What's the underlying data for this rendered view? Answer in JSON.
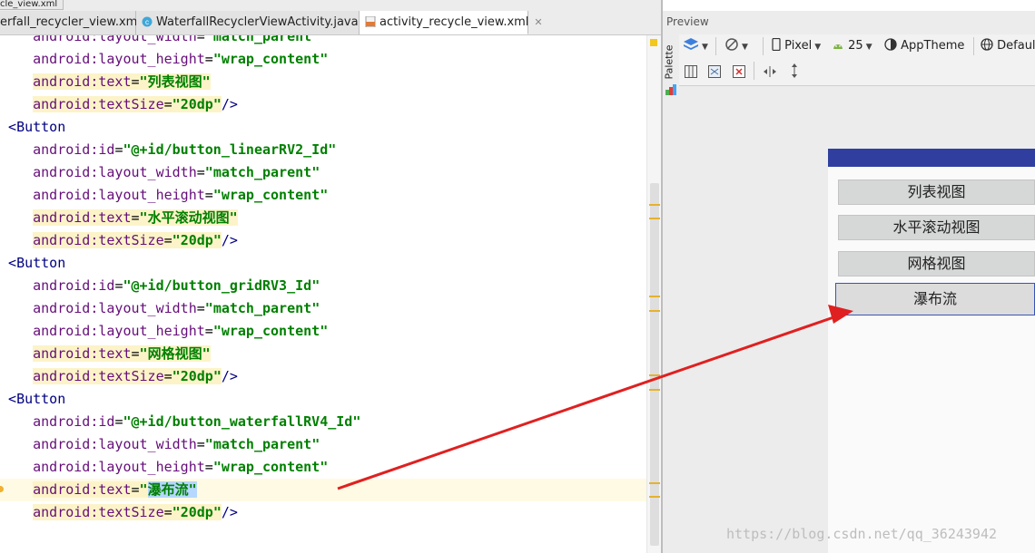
{
  "tabs": {
    "crumb": "cle_view.xml",
    "items": [
      {
        "label": "erfall_recycler_view.xml"
      },
      {
        "label": "WaterfallRecyclerViewActivity.java"
      },
      {
        "label": "activity_recycle_view.xml"
      }
    ]
  },
  "editor": {
    "lines": [
      {
        "indent": "    ",
        "attr": "android:layout_width",
        "value": "match_parent",
        "tail": ""
      },
      {
        "indent": "    ",
        "attr": "android:layout_height",
        "value": "wrap_content",
        "tail": ""
      },
      {
        "indent": "    ",
        "attr": "android:text",
        "value": "列表视图",
        "tail": ""
      },
      {
        "indent": "    ",
        "attr": "android:textSize",
        "value": "20dp",
        "tail": "/>"
      },
      {
        "tag": "Button"
      },
      {
        "indent": "    ",
        "attr": "android:id",
        "value": "@+id/button_linearRV2_Id",
        "tail": ""
      },
      {
        "indent": "    ",
        "attr": "android:layout_width",
        "value": "match_parent",
        "tail": ""
      },
      {
        "indent": "    ",
        "attr": "android:layout_height",
        "value": "wrap_content",
        "tail": ""
      },
      {
        "indent": "    ",
        "attr": "android:text",
        "value": "水平滚动视图",
        "tail": ""
      },
      {
        "indent": "    ",
        "attr": "android:textSize",
        "value": "20dp",
        "tail": "/>"
      },
      {
        "tag": "Button"
      },
      {
        "indent": "    ",
        "attr": "android:id",
        "value": "@+id/button_gridRV3_Id",
        "tail": ""
      },
      {
        "indent": "    ",
        "attr": "android:layout_width",
        "value": "match_parent",
        "tail": ""
      },
      {
        "indent": "    ",
        "attr": "android:layout_height",
        "value": "wrap_content",
        "tail": ""
      },
      {
        "indent": "    ",
        "attr": "android:text",
        "value": "网格视图",
        "tail": ""
      },
      {
        "indent": "    ",
        "attr": "android:textSize",
        "value": "20dp",
        "tail": "/>"
      },
      {
        "tag": "Button"
      },
      {
        "indent": "    ",
        "attr": "android:id",
        "value": "@+id/button_waterfallRV4_Id",
        "tail": ""
      },
      {
        "indent": "    ",
        "attr": "android:layout_width",
        "value": "match_parent",
        "tail": ""
      },
      {
        "indent": "    ",
        "attr": "android:layout_height",
        "value": "wrap_content",
        "tail": ""
      },
      {
        "indent": "    ",
        "attr": "android:text",
        "value": "瀑布流",
        "tail": ""
      },
      {
        "indent": "    ",
        "attr": "android:textSize",
        "value": "20dp",
        "tail": "/>"
      }
    ]
  },
  "preview": {
    "title": "Preview",
    "palette_label": "Palette",
    "toolbar": {
      "device": "Pixel",
      "api": "25",
      "theme": "AppTheme",
      "locale": "Default"
    },
    "buttons": [
      "列表视图",
      "水平滚动视图",
      "网格视图",
      "瀑布流"
    ],
    "accent_color": "#303f9f"
  },
  "watermark": "https://blog.csdn.net/qq_36243942"
}
